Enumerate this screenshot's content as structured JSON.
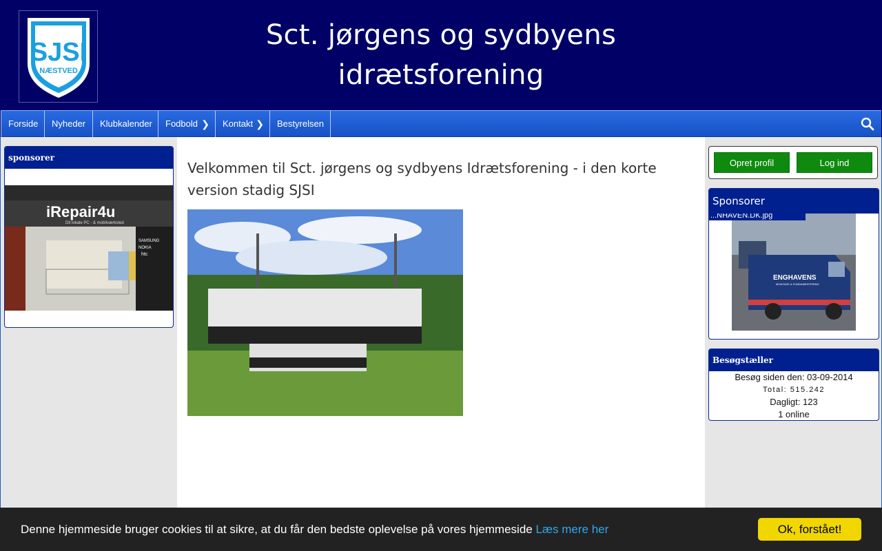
{
  "header": {
    "logo": {
      "line1": "SJSI",
      "line2": "NÆSTVED"
    },
    "title_line1": "Sct. jørgens og sydbyens",
    "title_line2": "idrætsforening"
  },
  "nav": {
    "items": [
      {
        "label": "Forside"
      },
      {
        "label": "Nyheder"
      },
      {
        "label": "Klubkalender"
      },
      {
        "label": "Fodbold",
        "has_submenu": true
      },
      {
        "label": "Kontakt",
        "has_submenu": true
      },
      {
        "label": "Bestyrelsen"
      }
    ],
    "search_icon": "search-icon"
  },
  "left_sidebar": {
    "title": "sponsorer",
    "sponsor_sign": "iRepair4u",
    "sponsor_tagline": "Dit lokale PC - & mobilværksted",
    "sponsor_brands": [
      "SAMSUNG",
      "NOKIA",
      "htc"
    ]
  },
  "main": {
    "heading": "Velkommen til Sct. jørgens og sydbyens Idrætsforening - i den korte version stadig SJSI"
  },
  "right_sidebar": {
    "login": {
      "create_profile": "Opret profil",
      "login": "Log ind"
    },
    "sponsor_title": "Sponsorer",
    "sponsor_caption": "...NHAVEN.DK.jpg",
    "van_brand": "ENGHAVENS",
    "van_subtitle": "MONTAGE & FUNDAMENTERING",
    "visitor": {
      "title": "Besøgstæller",
      "since": "Besøg siden den: 03-09-2014",
      "total": "Total: 515.242",
      "daily": "Dagligt: 123",
      "online": "1 online"
    }
  },
  "cookie": {
    "text": "Denne hjemmeside bruger cookies til at sikre, at du får den bedste oplevelse på vores hjemmeside",
    "link": "Læs mere her",
    "button": "Ok, forstået!"
  },
  "colors": {
    "header_bg": "#000066",
    "nav_blue": "#1652c8",
    "box_head": "#00208f",
    "green_button": "#0f8a0f",
    "cookie_button": "#f1d600",
    "cookie_link": "#31a8f0"
  }
}
